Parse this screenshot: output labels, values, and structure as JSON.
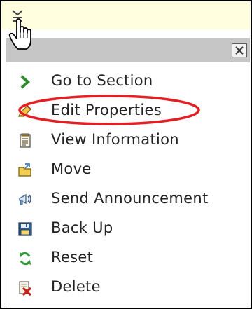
{
  "menu": {
    "items": [
      {
        "label": "Go to Section",
        "icon": "arrow-right-icon"
      },
      {
        "label": "Edit Properties",
        "icon": "pencil-icon"
      },
      {
        "label": "View Information",
        "icon": "document-icon"
      },
      {
        "label": "Move",
        "icon": "folder-move-icon"
      },
      {
        "label": "Send Announcement",
        "icon": "megaphone-icon"
      },
      {
        "label": "Back Up",
        "icon": "floppy-disk-icon"
      },
      {
        "label": "Reset",
        "icon": "refresh-icon"
      },
      {
        "label": "Delete",
        "icon": "delete-icon"
      }
    ],
    "close_icon": "close-icon",
    "trigger_icon": "menu-trigger-icon"
  },
  "annotation": {
    "highlighted_item": "Edit Properties",
    "color": "#e41f24"
  },
  "colors": {
    "background_top": "#ffffe0",
    "menu_header": "#c6c6c6",
    "text": "#222222"
  }
}
